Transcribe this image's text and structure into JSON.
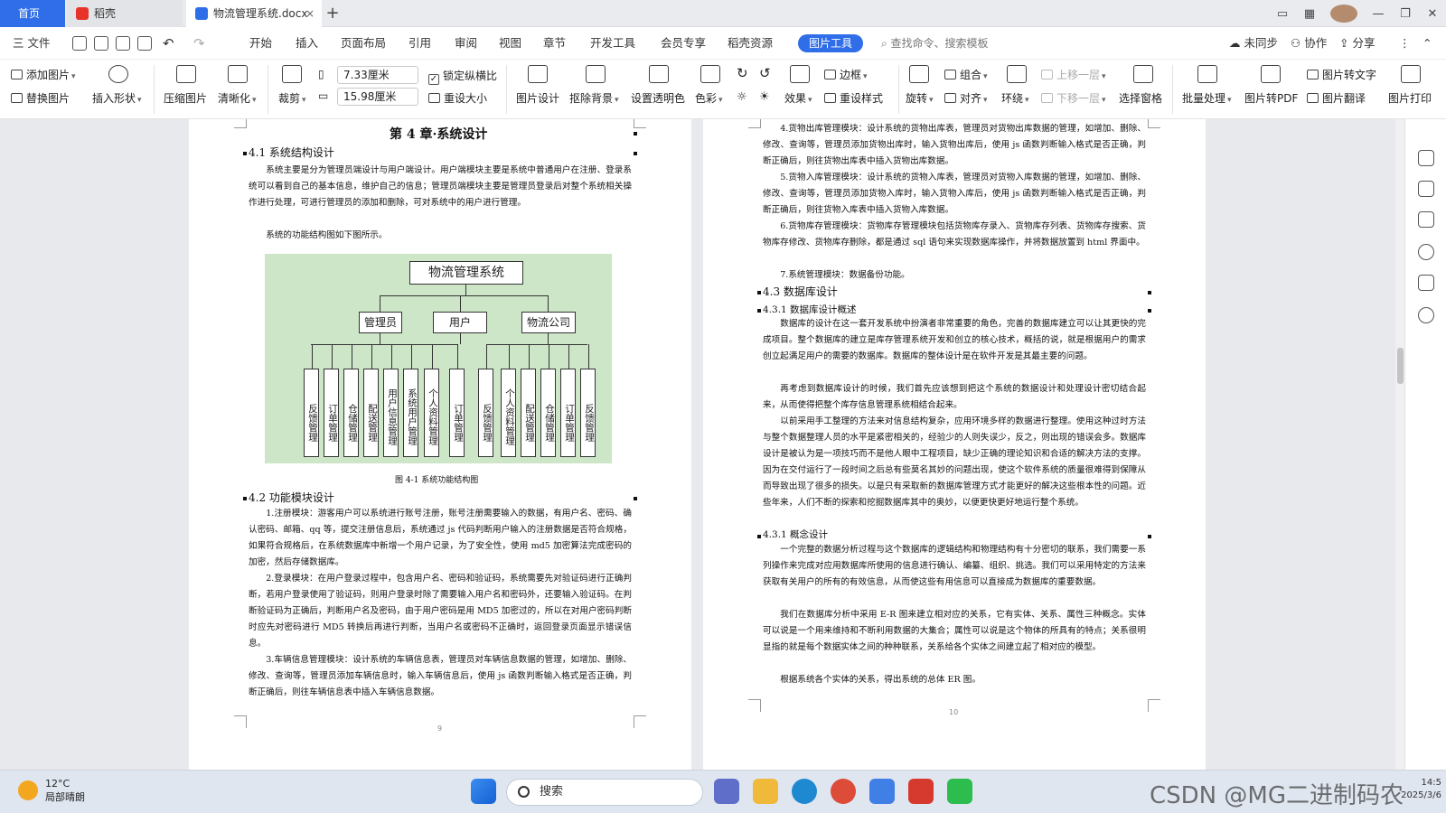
{
  "tabs": {
    "home": "首页",
    "t1": "稻壳",
    "t2": "物流管理系统.docx",
    "plus": "+"
  },
  "window": {
    "min": "—",
    "max": "❐",
    "close": "✕"
  },
  "menu": {
    "file": "三 文件",
    "items": [
      "开始",
      "插入",
      "页面布局",
      "引用",
      "审阅",
      "视图",
      "章节",
      "开发工具",
      "会员专享",
      "稻壳资源"
    ],
    "active": "图片工具",
    "search": "查找命令、搜索模板",
    "sync": "未同步",
    "collab": "协作",
    "share": "分享"
  },
  "ribbon": {
    "add_image": "添加图片",
    "replace_image": "替换图片",
    "insert_shape": "插入形状",
    "compress": "压缩图片",
    "sharpen": "清晰化",
    "crop": "裁剪",
    "width": "7.33厘米",
    "height": "15.98厘米",
    "lock_ratio": "锁定纵横比",
    "reset_size": "重设大小",
    "image_design": "图片设计",
    "remove_bg": "抠除背景",
    "set_transparent": "设置透明色",
    "color": "色彩",
    "effects": "效果",
    "border": "边框",
    "reset_style": "重设样式",
    "rotate": "旋转",
    "group": "组合",
    "align": "对齐",
    "wrap": "环绕",
    "bring_forward": "上移一层",
    "send_backward": "下移一层",
    "selection_pane": "选择窗格",
    "batch": "批量处理",
    "to_pdf": "图片转PDF",
    "to_text": "图片转文字",
    "translate": "图片翻译",
    "print": "图片打印"
  },
  "page1": {
    "chapter": "第 4 章·系统设计",
    "h41": "4.1  系统结构设计",
    "p1": "系统主要是分为管理员端设计与用户端设计。用户端模块主要是系统中普通用户在注册、登录系统可以看到自己的基本信息，维护自己的信息；管理员端模块主要是管理员登录后对整个系统相关操作进行处理，可进行管理员的添加和删除，可对系统中的用户进行管理。",
    "p2": "系统的功能结构图如下图所示。",
    "caption": "图 4-1  系统功能结构图",
    "h42": "4.2  功能模块设计",
    "p3": "1.注册模块：游客用户可以系统进行账号注册，账号注册需要输入的数据，有用户名、密码、确认密码、邮箱、qq 等，提交注册信息后，系统通过 js 代码判断用户输入的注册数据是否符合规格，如果符合规格后，在系统数据库中新增一个用户记录，为了安全性，使用 md5 加密算法完成密码的加密，然后存储数据库。",
    "p4": "2.登录模块：在用户登录过程中，包含用户名、密码和验证码，系统需要先对验证码进行正确判断，若用户登录使用了验证码，则用户登录时除了需要输入用户名和密码外，还要输入验证码。在判断验证码为正确后，判断用户名及密码，由于用户密码是用 MD5 加密过的，所以在对用户密码判断时应先对密码进行 MD5 转换后再进行判断，当用户名或密码不正确时，返回登录页面显示错误信息。",
    "p5": "3.车辆信息管理模块：设计系统的车辆信息表，管理员对车辆信息数据的管理，如增加、删除、修改、查询等，管理员添加车辆信息时，输入车辆信息后，使用 js 函数判断输入格式是否正确，判断正确后，则往车辆信息表中插入车辆信息数据。",
    "pgnum": "9"
  },
  "diagram": {
    "root": "物流管理系统",
    "groups": [
      "管理员",
      "用户",
      "物流公司"
    ],
    "leaves": [
      "反馈管理",
      "订单管理",
      "仓储管理",
      "配送管理",
      "用户信息管理",
      "系统用户管理",
      "个人资料管理",
      "订单管理",
      "反馈管理",
      "个人资料管理",
      "配送管理",
      "仓储管理",
      "订单管理",
      "反馈管理"
    ]
  },
  "page2": {
    "p1": "4.货物出库管理模块：设计系统的货物出库表，管理员对货物出库数据的管理，如增加、删除、修改、查询等，管理员添加货物出库时，输入货物出库后，使用 js 函数判断输入格式是否正确，判断正确后，则往货物出库表中插入货物出库数据。",
    "p2": "5.货物入库管理模块：设计系统的货物入库表，管理员对货物入库数据的管理，如增加、删除、修改、查询等，管理员添加货物入库时，输入货物入库后，使用 js 函数判断输入格式是否正确，判断正确后，则往货物入库表中插入货物入库数据。",
    "p3": "6.货物库存管理模块：货物库存管理模块包括货物库存录入、货物库存列表、货物库存搜索、货物库存修改、货物库存删除，都是通过 sql 语句来实现数据库操作，并将数据放置到 html 界面中。",
    "p4": "7.系统管理模块：数据备份功能。",
    "h43": "4.3  数据库设计",
    "h431": "4.3.1  数据库设计概述",
    "p5": "数据库的设计在这一套开发系统中扮演者非常重要的角色，完善的数据库建立可以让其更快的完成项目。整个数据库的建立是库存管理系统开发和创立的核心技术，概括的说，就是根据用户的需求创立起满足用户的需要的数据库。数据库的整体设计是在软件开发是其最主要的问题。",
    "p6": "再考虑到数据库设计的时候，我们首先应该想到把这个系统的数据设计和处理设计密切结合起来，从而使得把整个库存信息管理系统相结合起来。",
    "p7": "以前采用手工整理的方法来对信息结构复杂，应用环境多样的数据进行整理。使用这种过时方法与整个数据整理人员的水平是紧密相关的，经验少的人则失误少，反之，则出现的错误会多。数据库设计是被认为是一项技巧而不是他人眼中工程项目，缺少正确的理论知识和合适的解决方法的支撑。因为在交付运行了一段时间之后总有些莫名其妙的问题出现，使这个软件系统的质量很难得到保障从而导致出现了很多的损失。以是只有采取新的数据库管理方式才能更好的解决这些根本性的问题。近些年来，人们不断的探索和挖掘数据库其中的奥妙，以便更快更好地运行整个系统。",
    "h432": "4.3.1  概念设计",
    "p8": "一个完整的数据分析过程与这个数据库的逻辑结构和物理结构有十分密切的联系，我们需要一系列操作来完成对应用数据库所使用的信息进行确认、编纂、组织、挑选。我们可以采用特定的方法来获取有关用户的所有的有效信息，从而使这些有用信息可以直接成为数据库的重要数据。",
    "p9": "我们在数据库分析中采用 E-R 图来建立相对应的关系，它有实体、关系、属性三种概念。实体可以说是一个用来维持和不断利用数据的大集合；属性可以说是这个物体的所具有的特点；关系很明显指的就是每个数据实体之间的种种联系，关系给各个实体之间建立起了相对应的模型。",
    "p10": "根据系统各个实体的关系，得出系统的总体 ER 图。",
    "pgnum": "10"
  },
  "taskbar": {
    "temp": "12°C",
    "weather": "局部晴朗",
    "search": "搜索"
  },
  "watermark": "CSDN @MG二进制码农",
  "clock": {
    "time": "14:5",
    "date": "2025/3/6"
  }
}
